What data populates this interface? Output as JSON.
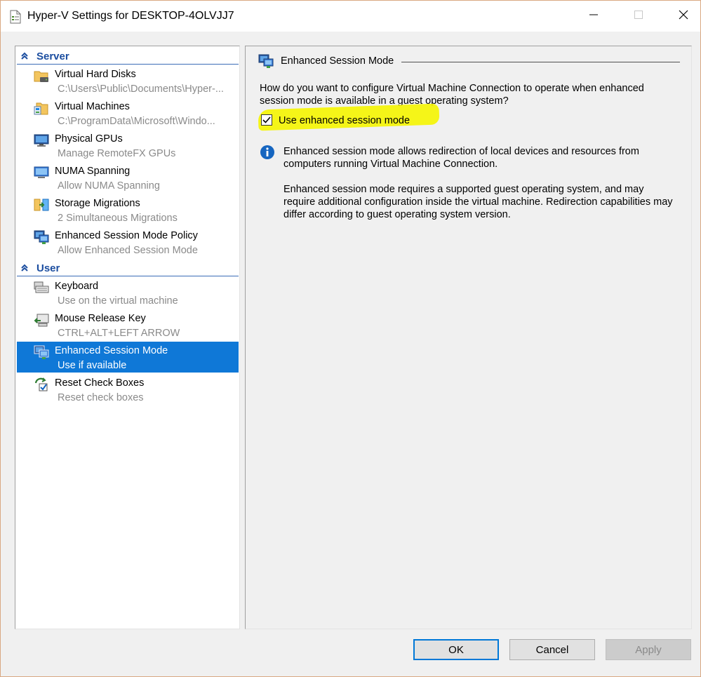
{
  "window": {
    "title": "Hyper-V Settings for DESKTOP-4OLVJJ7"
  },
  "sidebar": {
    "sections": [
      {
        "header": "Server",
        "items": [
          {
            "name": "Virtual Hard Disks",
            "sub": "C:\\Users\\Public\\Documents\\Hyper-...",
            "icon": "folder-drive-icon"
          },
          {
            "name": "Virtual Machines",
            "sub": "C:\\ProgramData\\Microsoft\\Windo...",
            "icon": "folder-vm-icon"
          },
          {
            "name": "Physical GPUs",
            "sub": "Manage RemoteFX GPUs",
            "icon": "gpu-icon"
          },
          {
            "name": "NUMA Spanning",
            "sub": "Allow NUMA Spanning",
            "icon": "monitor-icon"
          },
          {
            "name": "Storage Migrations",
            "sub": "2 Simultaneous Migrations",
            "icon": "storage-migration-icon"
          },
          {
            "name": "Enhanced Session Mode Policy",
            "sub": "Allow Enhanced Session Mode",
            "icon": "enhanced-session-icon"
          }
        ]
      },
      {
        "header": "User",
        "items": [
          {
            "name": "Keyboard",
            "sub": "Use on the virtual machine",
            "icon": "keyboard-icon"
          },
          {
            "name": "Mouse Release Key",
            "sub": "CTRL+ALT+LEFT ARROW",
            "icon": "mouse-release-icon"
          },
          {
            "name": "Enhanced Session Mode",
            "sub": "Use if available",
            "icon": "enhanced-session-icon",
            "selected": true
          },
          {
            "name": "Reset Check Boxes",
            "sub": "Reset check boxes",
            "icon": "reset-checkbox-icon"
          }
        ]
      }
    ]
  },
  "content": {
    "group_title": "Enhanced Session Mode",
    "question": "How do you want to configure Virtual Machine Connection to operate when enhanced session mode is available in a guest operating system?",
    "checkbox_label": "Use enhanced session mode",
    "checkbox_checked": true,
    "info_1": "Enhanced session mode allows redirection of local devices and resources from computers running Virtual Machine Connection.",
    "info_2": "Enhanced session mode requires a supported guest operating system, and may require additional configuration inside the virtual machine. Redirection capabilities may differ according to guest operating system version."
  },
  "buttons": {
    "ok": "OK",
    "cancel": "Cancel",
    "apply": "Apply"
  },
  "colors": {
    "selection": "#0f78d7",
    "section_header": "#1c4ea0",
    "highlight": "#f5f500",
    "info_icon": "#1565c0"
  }
}
